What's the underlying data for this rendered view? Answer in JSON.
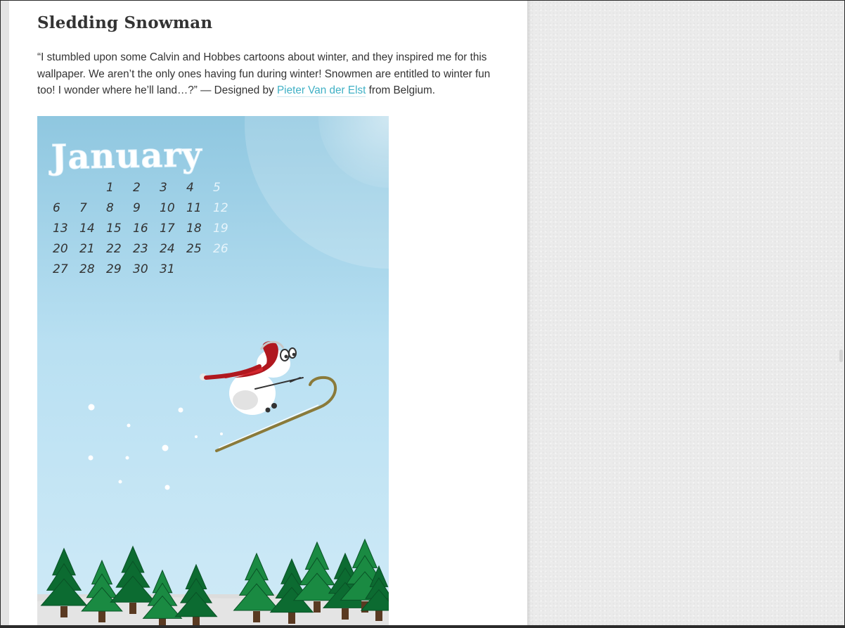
{
  "article": {
    "title": "Sledding Snowman",
    "description_before_link": "“I stumbled upon some Calvin and Hobbes cartoons about winter, and they inspired me for this wallpaper. We aren’t the only ones having fun during winter! Snowmen are entitled to winter fun too! I wonder where he’ll land…?” — Designed by ",
    "designer_link": "Pieter Van der Elst",
    "description_after_link": " from Belgium."
  },
  "wallpaper": {
    "month": "January",
    "calendar_rows": [
      [
        "",
        "",
        "1",
        "2",
        "3",
        "4",
        "5"
      ],
      [
        "6",
        "7",
        "8",
        "9",
        "10",
        "11",
        "12"
      ],
      [
        "13",
        "14",
        "15",
        "16",
        "17",
        "18",
        "19"
      ],
      [
        "20",
        "21",
        "22",
        "23",
        "24",
        "25",
        "26"
      ],
      [
        "27",
        "28",
        "29",
        "30",
        "31",
        "",
        ""
      ]
    ],
    "colors": {
      "sky_top": "#8fc7e0",
      "sky_bottom": "#cfeaf7",
      "weekend": "#e6f4fb",
      "weekday": "#333333",
      "tree_dark": "#0c6b31",
      "tree_light": "#1a8a42",
      "hat_red": "#b0181f",
      "sled": "#8a7a3a"
    }
  },
  "colors": {
    "link": "#3fb0c5",
    "text": "#333333"
  }
}
